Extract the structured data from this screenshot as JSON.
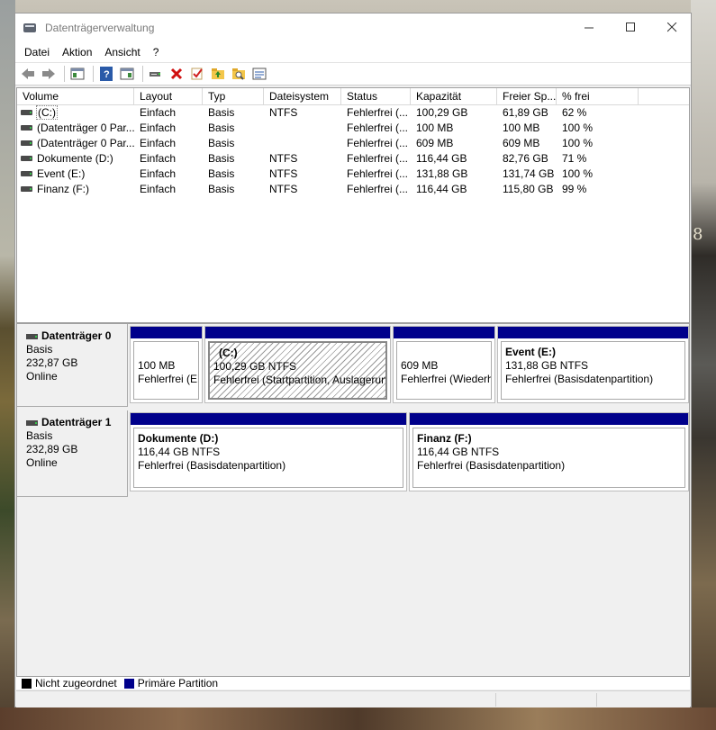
{
  "window": {
    "title": "Datenträgerverwaltung"
  },
  "menu": [
    "Datei",
    "Aktion",
    "Ansicht",
    "?"
  ],
  "toolbar": [
    "back-icon",
    "forward-icon",
    "view-panel-icon",
    "help-icon",
    "properties-panel-icon",
    "connect-icon",
    "delete-icon",
    "check-icon",
    "folder-up-icon",
    "folder-search-icon",
    "list-view-icon"
  ],
  "columns": [
    "Volume",
    "Layout",
    "Typ",
    "Dateisystem",
    "Status",
    "Kapazität",
    "Freier Sp...",
    "% frei"
  ],
  "volumes": [
    [
      "(C:)",
      "Einfach",
      "Basis",
      "NTFS",
      "Fehlerfrei (...",
      "100,29 GB",
      "61,89 GB",
      "62 %"
    ],
    [
      "(Datenträger 0 Par...",
      "Einfach",
      "Basis",
      "",
      "Fehlerfrei (...",
      "100 MB",
      "100 MB",
      "100 %"
    ],
    [
      "(Datenträger 0 Par...",
      "Einfach",
      "Basis",
      "",
      "Fehlerfrei (...",
      "609 MB",
      "609 MB",
      "100 %"
    ],
    [
      "Dokumente (D:)",
      "Einfach",
      "Basis",
      "NTFS",
      "Fehlerfrei (...",
      "116,44 GB",
      "82,76 GB",
      "71 %"
    ],
    [
      "Event (E:)",
      "Einfach",
      "Basis",
      "NTFS",
      "Fehlerfrei (...",
      "131,88 GB",
      "131,74 GB",
      "100 %"
    ],
    [
      "Finanz (F:)",
      "Einfach",
      "Basis",
      "NTFS",
      "Fehlerfrei (...",
      "116,44 GB",
      "115,80 GB",
      "99 %"
    ]
  ],
  "disks": [
    {
      "name": "Datenträger 0",
      "type": "Basis",
      "size": "232,87 GB",
      "state": "Online",
      "partitions": [
        {
          "title": "",
          "size": "100 MB",
          "status": "Fehlerfrei (EF"
        },
        {
          "title": "(C:)",
          "size": "100,29 GB NTFS",
          "status": "Fehlerfrei (Startpartition, Auslagerun"
        },
        {
          "title": "",
          "size": "609 MB",
          "status": "Fehlerfrei (Wiederh"
        },
        {
          "title": "Event  (E:)",
          "size": "131,88 GB NTFS",
          "status": "Fehlerfrei (Basisdatenpartition)"
        }
      ]
    },
    {
      "name": "Datenträger 1",
      "type": "Basis",
      "size": "232,89 GB",
      "state": "Online",
      "partitions": [
        {
          "title": "Dokumente  (D:)",
          "size": "116,44 GB NTFS",
          "status": "Fehlerfrei (Basisdatenpartition)"
        },
        {
          "title": "Finanz  (F:)",
          "size": "116,44 GB NTFS",
          "status": "Fehlerfrei (Basisdatenpartition)"
        }
      ]
    }
  ],
  "legend": {
    "unallocated": "Nicht zugeordnet",
    "unallocated_color": "#000000",
    "primary": "Primäre Partition",
    "primary_color": "#00008b"
  },
  "background": {
    "overlay_text": "8"
  }
}
